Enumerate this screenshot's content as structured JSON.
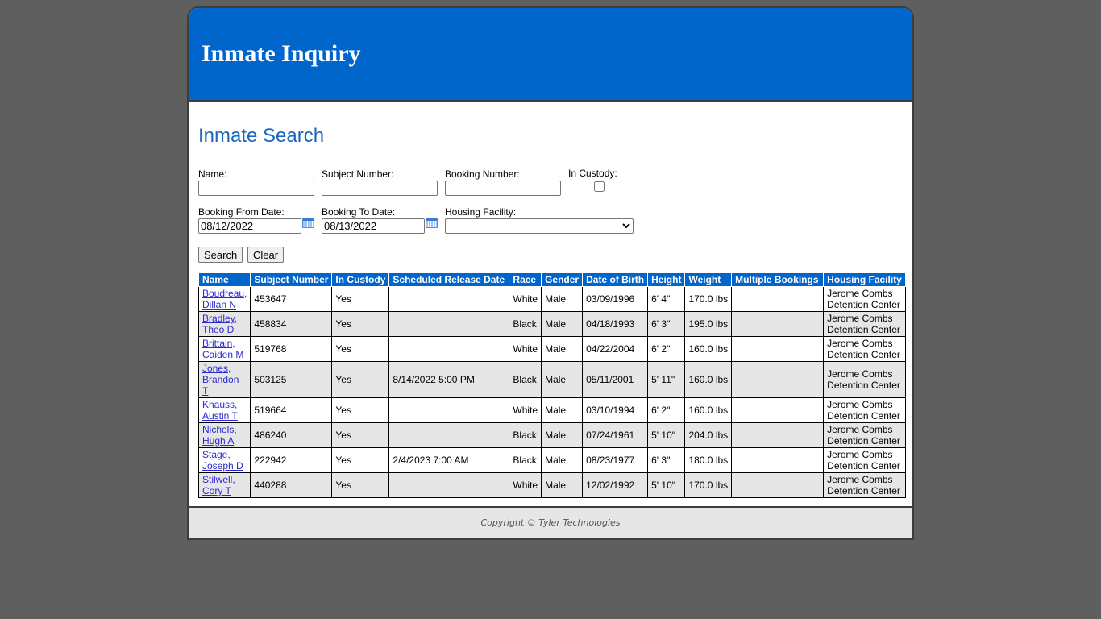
{
  "header": {
    "title": "Inmate Inquiry"
  },
  "search": {
    "title": "Inmate Search",
    "fields": {
      "name": {
        "label": "Name:",
        "value": ""
      },
      "subject_number": {
        "label": "Subject Number:",
        "value": ""
      },
      "booking_number": {
        "label": "Booking Number:",
        "value": ""
      },
      "in_custody": {
        "label": "In Custody:",
        "checked": false
      },
      "booking_from_date": {
        "label": "Booking From Date:",
        "value": "08/12/2022"
      },
      "booking_to_date": {
        "label": "Booking To Date:",
        "value": "08/13/2022"
      },
      "housing_facility": {
        "label": "Housing Facility:",
        "value": ""
      }
    },
    "buttons": {
      "search": "Search",
      "clear": "Clear"
    }
  },
  "results": {
    "columns": [
      "Name",
      "Subject Number",
      "In Custody",
      "Scheduled Release Date",
      "Race",
      "Gender",
      "Date of Birth",
      "Height",
      "Weight",
      "Multiple Bookings",
      "Housing Facility"
    ],
    "rows": [
      {
        "name": "Boudreau, Dillan N",
        "subject_number": "453647",
        "in_custody": "Yes",
        "release": "",
        "race": "White",
        "gender": "Male",
        "dob": "03/09/1996",
        "height": "6' 4\"",
        "weight": "170.0 lbs",
        "multiple": "",
        "facility": "Jerome Combs Detention Center"
      },
      {
        "name": "Bradley, Theo D",
        "subject_number": "458834",
        "in_custody": "Yes",
        "release": "",
        "race": "Black",
        "gender": "Male",
        "dob": "04/18/1993",
        "height": "6' 3\"",
        "weight": "195.0 lbs",
        "multiple": "",
        "facility": "Jerome Combs Detention Center"
      },
      {
        "name": "Brittain, Caiden M",
        "subject_number": "519768",
        "in_custody": "Yes",
        "release": "",
        "race": "White",
        "gender": "Male",
        "dob": "04/22/2004",
        "height": "6' 2\"",
        "weight": "160.0 lbs",
        "multiple": "",
        "facility": "Jerome Combs Detention Center"
      },
      {
        "name": "Jones, Brandon T",
        "subject_number": "503125",
        "in_custody": "Yes",
        "release": "8/14/2022 5:00 PM",
        "race": "Black",
        "gender": "Male",
        "dob": "05/11/2001",
        "height": "5' 11\"",
        "weight": "160.0 lbs",
        "multiple": "",
        "facility": "Jerome Combs Detention Center"
      },
      {
        "name": "Knauss, Austin T",
        "subject_number": "519664",
        "in_custody": "Yes",
        "release": "",
        "race": "White",
        "gender": "Male",
        "dob": "03/10/1994",
        "height": "6' 2\"",
        "weight": "160.0 lbs",
        "multiple": "",
        "facility": "Jerome Combs Detention Center"
      },
      {
        "name": "Nichols, Hugh A",
        "subject_number": "486240",
        "in_custody": "Yes",
        "release": "",
        "race": "Black",
        "gender": "Male",
        "dob": "07/24/1961",
        "height": "5' 10\"",
        "weight": "204.0 lbs",
        "multiple": "",
        "facility": "Jerome Combs Detention Center"
      },
      {
        "name": "Stage, Joseph D",
        "subject_number": "222942",
        "in_custody": "Yes",
        "release": "2/4/2023 7:00 AM",
        "race": "Black",
        "gender": "Male",
        "dob": "08/23/1977",
        "height": "6' 3\"",
        "weight": "180.0 lbs",
        "multiple": "",
        "facility": "Jerome Combs Detention Center"
      },
      {
        "name": "Stilwell, Cory T",
        "subject_number": "440288",
        "in_custody": "Yes",
        "release": "",
        "race": "White",
        "gender": "Male",
        "dob": "12/02/1992",
        "height": "5' 10\"",
        "weight": "170.0 lbs",
        "multiple": "",
        "facility": "Jerome Combs Detention Center"
      }
    ]
  },
  "footer": {
    "copyright": "Copyright © Tyler Technologies"
  }
}
